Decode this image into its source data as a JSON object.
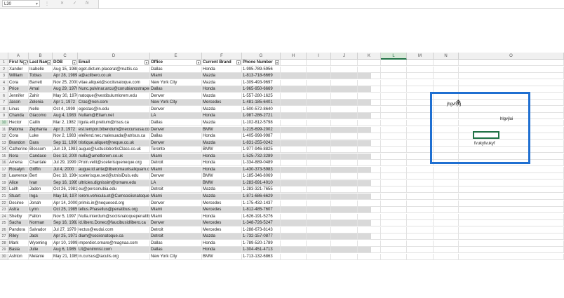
{
  "formula_bar": {
    "name_box": "L30",
    "cancel_symbol": "✕",
    "enter_symbol": "✓",
    "fx_symbol": "fx",
    "formula": ""
  },
  "columns": [
    "A",
    "B",
    "C",
    "D",
    "E",
    "F",
    "G",
    "H",
    "I",
    "J",
    "K",
    "L",
    "M",
    "N",
    "O"
  ],
  "selected_column": "L",
  "selected_row": "10",
  "headers": [
    "First Name",
    "Last Name",
    "DOB",
    "Email",
    "Office",
    "Current Brand",
    "Phone Number"
  ],
  "rows": [
    [
      "Xander",
      "Isabelle",
      "Aug 15, 1988",
      "eget.dictum.placerat@mattis.ca",
      "Dallas",
      "Honda",
      "1-995-789-5956"
    ],
    [
      "William",
      "Tobias",
      "Apr 28, 1989",
      "a@aclibero.co.uk",
      "Miami",
      "Mazda",
      "1-813-718-6669"
    ],
    [
      "Cora",
      "Barrett",
      "Nov 25, 2000",
      "vitae.aliquet@sociisnatoque.com",
      "New York City",
      "Mazda",
      "1-309-493-9697"
    ],
    [
      "Price",
      "Amal",
      "Aug 29, 1976",
      "Nunc.pulvinar.arcu@conubianostraper.edu",
      "Dallas",
      "Honda",
      "1-965-950-6669"
    ],
    [
      "Jennifer",
      "Zahir",
      "May 30, 1976",
      "natoque@vestibulumlorem.edu",
      "Denver",
      "Mazda",
      "1-557-280-1625"
    ],
    [
      "Jason",
      "Zelenia",
      "Apr 1, 1972",
      "Cras@non.com",
      "New York City",
      "Mercedes",
      "1-481-185-6401"
    ],
    [
      "Linus",
      "Nelle",
      "Oct 4, 1999",
      "egestas@in.edu",
      "Denver",
      "Mazda",
      "1-500-572-8640"
    ],
    [
      "Chanda",
      "Giacomo",
      "Aug 4, 1983",
      "Nullam@Etiam.net",
      "LA",
      "Honda",
      "1-987-286-2721"
    ],
    [
      "Hector",
      "Cailin",
      "Mar 2, 1982",
      "ligula.elit.pretium@risus.ca",
      "Dallas",
      "Mazda",
      "1-102-812-5798"
    ],
    [
      "Paloma",
      "Zephania",
      "Apr 3, 1972",
      "est.tempor.bibendum@neccursusa.com",
      "Denver",
      "BMW",
      "1-215-699-2002"
    ],
    [
      "Cora",
      "Luke",
      "Nov 2, 1983",
      "eleifend.nec.malesuada@atrisus.ca",
      "Dallas",
      "Honda",
      "1-405-998-9987"
    ],
    [
      "Brandon",
      "Dara",
      "Sep 11, 1990",
      "tristique.aliquet@neque.co.uk",
      "Denver",
      "Mazda",
      "1-831-255-0242"
    ],
    [
      "Catherine",
      "Blossom",
      "Jun 19, 1983",
      "augue@luctuslobortisClass.co.uk",
      "Toronto",
      "BMW",
      "1-977-946-8825"
    ],
    [
      "Nora",
      "Candace",
      "Dec 13, 2000",
      "nulla@ametlorem.co.uk",
      "Miami",
      "Honda",
      "1-525-732-3289"
    ],
    [
      "Amena",
      "Chantale",
      "Jul 29, 1999",
      "Proin.velit@scelerisqueneque.org",
      "Detroit",
      "Honda",
      "1-334-889-0489"
    ],
    [
      "Rosalyn",
      "Griffin",
      "Jul 4, 2000",
      "augue.id.ante@liberomaurisaliquam.co.uk",
      "Miami",
      "Honda",
      "1-430-373-5983"
    ],
    [
      "Lawrence",
      "Bert",
      "Dec 18, 1984",
      "scelerisque.sed@utnisiDuis.edu",
      "Denver",
      "BMW",
      "1-185-346-8069"
    ],
    [
      "Alice",
      "Ivan",
      "Sep 16, 1995",
      "ultricies.dignissim@ornare.edu",
      "LA",
      "BMW",
      "1-283-691-4010"
    ],
    [
      "Laith",
      "Jaden",
      "Oct 26, 1981",
      "eu@perconubia.edu",
      "Detroit",
      "Mazda",
      "1-283-321-7655"
    ],
    [
      "Stuart",
      "Inga",
      "May 18, 1978",
      "lorem.vehicula.et@Cumsociisnatoque.edu",
      "Miami",
      "Mazda",
      "1-871-686-6629"
    ],
    [
      "Desiree",
      "Jonah",
      "Apr 14, 2000",
      "primis.in@nequesed.org",
      "Denver",
      "Mercedes",
      "1-175-432-1437"
    ],
    [
      "Astra",
      "Lynn",
      "Oct 25, 1985",
      "tellus.Phasellus@penatibus.org",
      "Miami",
      "Mercedes",
      "1-812-485-7607"
    ],
    [
      "Shelby",
      "Fallon",
      "Nov 5, 1997",
      "Nulla.interdum@sociisnatoquepenatibus.co.uk",
      "Miami",
      "Honda",
      "1-626-191-5276"
    ],
    [
      "Sacha",
      "Norman",
      "Sep 16, 1982",
      "id.libero.Donec@faucibusidlibero.ca",
      "Denver",
      "Mercedes",
      "1-348-726-5247"
    ],
    [
      "Pandora",
      "Salvador",
      "Jul 27, 1979",
      "lectus@eudui.com",
      "Detroit",
      "Mercedes",
      "1-288-673-8143"
    ],
    [
      "Riley",
      "Jack",
      "Apr 25, 1971",
      "diam@sociisnatoque.ca",
      "Detroit",
      "Mazda",
      "1-732-157-0877"
    ],
    [
      "Mark",
      "Wyoming",
      "Apr 10, 1999",
      "imperdiet.ornare@magnaa.com",
      "Dallas",
      "Honda",
      "1-789-520-1789"
    ],
    [
      "Basia",
      "Julie",
      "Aug 6, 1985",
      "Ut@enimnisl.com",
      "Dallas",
      "Honda",
      "1-304-451-4713"
    ],
    [
      "Ashton",
      "Melanie",
      "May 21, 1985",
      "in.cursus@iaculis.org",
      "New York City",
      "BMW",
      "1-713-132-6863"
    ]
  ],
  "row_numbers": [
    "1",
    "2",
    "3",
    "4",
    "5",
    "6",
    "7",
    "8",
    "9",
    "10",
    "11",
    "12",
    "13",
    "14",
    "15",
    "16",
    "17",
    "18",
    "19",
    "20",
    "21",
    "22",
    "23",
    "24",
    "25",
    "26",
    "27",
    "28",
    "29",
    "30"
  ],
  "free_cells": {
    "text1": "jhgvhjlg",
    "text2": "hlgvjlui",
    "text3": "fvukyfvukyf"
  },
  "colors": {
    "accent": "#217346",
    "highlight_box": "#1f6fd1",
    "band": "#d9d9d9"
  }
}
